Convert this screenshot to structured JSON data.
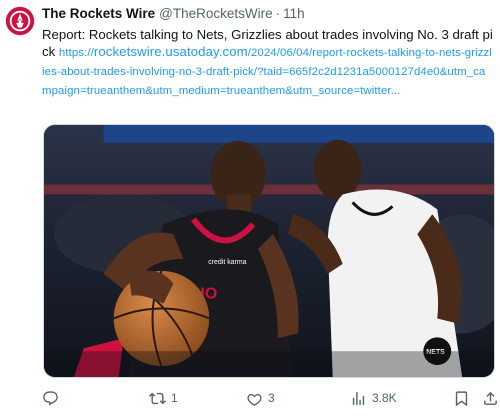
{
  "author": {
    "name": "The Rockets Wire",
    "handle": "@TheRocketsWire",
    "separator": "·",
    "time": "11h",
    "avatar_icon": "rockets-wire-logo-icon",
    "avatar_color": "#ce1141"
  },
  "tweet": {
    "text": "Report: Rockets talking to Nets, Grizzlies about trades involving No. 3 draft pick",
    "link_prefix": "https://",
    "link_domain": "rocketswire.usatoday.com",
    "link_rest": "/2024/06/04/report-rockets-talking-to-nets-grizzlies-about-trades-involving-no-3-draft-pick/?taid=665f2c2d1231a5000127d4e0&utm_campaign=trueanthem&utm_medium=trueanthem&utm_source=twitter..."
  },
  "media": {
    "image_icon": "basketball-game-photo",
    "jersey_brand": "credit karma",
    "jersey_partial": "HO",
    "opponent_logo": "NETS",
    "accent_red": "#ce1141"
  },
  "actions": {
    "reply": {
      "icon": "reply-icon",
      "count": ""
    },
    "retweet": {
      "icon": "retweet-icon",
      "count": "1"
    },
    "like": {
      "icon": "heart-icon",
      "count": "3"
    },
    "views": {
      "icon": "views-chart-icon",
      "count": "3.8K"
    },
    "bookmark": {
      "icon": "bookmark-icon"
    },
    "share": {
      "icon": "share-icon"
    }
  },
  "colors": {
    "text": "#0f1419",
    "muted": "#536471",
    "link": "#1d9bf0"
  }
}
